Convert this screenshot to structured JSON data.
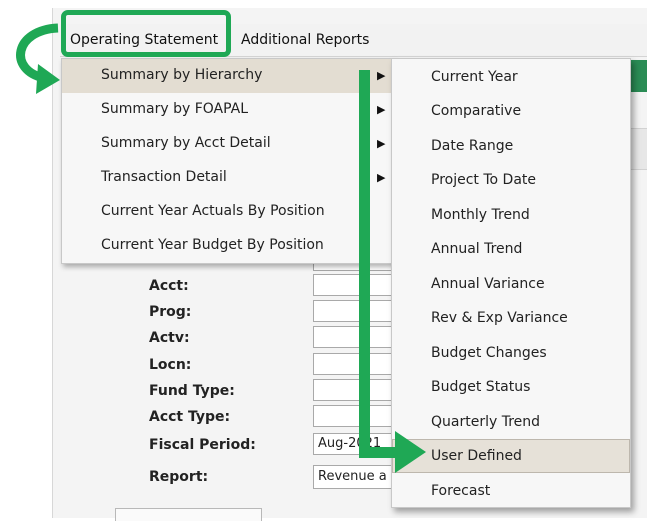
{
  "menubar": {
    "items": [
      "Operating Statement",
      "Additional Reports"
    ]
  },
  "dropdown": {
    "items": [
      {
        "label": "Summary by Hierarchy",
        "submenu": true
      },
      {
        "label": "Summary by FOAPAL",
        "submenu": true
      },
      {
        "label": "Summary by Acct Detail",
        "submenu": true
      },
      {
        "label": "Transaction Detail",
        "submenu": true
      },
      {
        "label": "Current Year Actuals By Position",
        "submenu": false
      },
      {
        "label": "Current Year Budget By Position",
        "submenu": false
      }
    ],
    "arrow_glyph": "▶"
  },
  "submenu": {
    "items": [
      "Current Year",
      "Comparative",
      "Date Range",
      "Project To Date",
      "Monthly Trend",
      "Annual Trend",
      "Annual Variance",
      "Rev & Exp Variance",
      "Budget Changes",
      "Budget Status",
      "Quarterly Trend",
      "User Defined",
      "Forecast"
    ],
    "selected": "User Defined"
  },
  "form": {
    "labels": [
      "Acct:",
      "Prog:",
      "Actv:",
      "Locn:",
      "Fund Type:",
      "Acct Type:",
      "Fiscal Period:",
      "Report:"
    ],
    "fiscal_period_value": "Aug-2021",
    "report_value": "Revenue a"
  },
  "colors": {
    "highlight_green": "#1fa855",
    "hover_bg": "#e3ddd2"
  }
}
